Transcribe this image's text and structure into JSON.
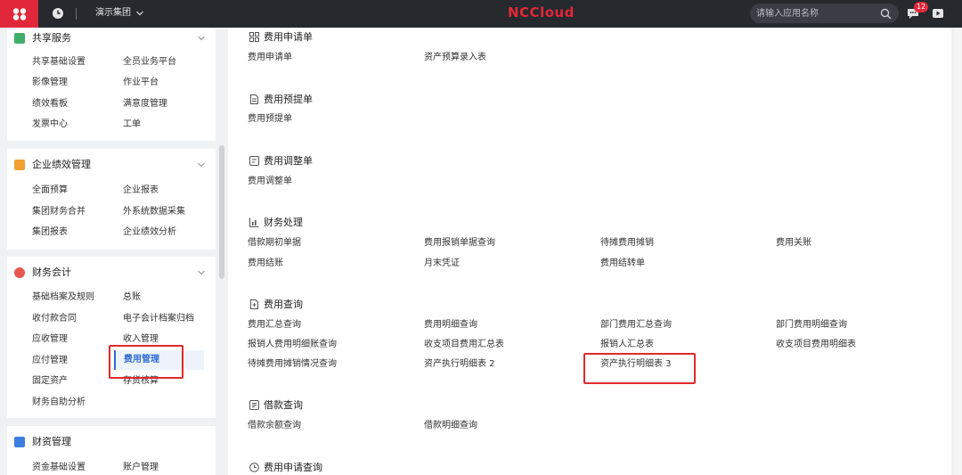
{
  "topbar": {
    "group_name": "演示集团",
    "brand": "NCCloud",
    "search_placeholder": "请输入应用名称",
    "message_count": "12"
  },
  "sidebar": {
    "sections": [
      {
        "title": "共享服务",
        "items": [
          "共享基础设置",
          "全员业务平台",
          "影像管理",
          "作业平台",
          "绩效看板",
          "满意度管理",
          "发票中心",
          "工单"
        ]
      },
      {
        "title": "企业绩效管理",
        "items": [
          "全面预算",
          "企业报表",
          "集团财务合并",
          "外系统数据采集",
          "集团报表",
          "企业绩效分析"
        ]
      },
      {
        "title": "财务会计",
        "items": [
          "基础档案及规则",
          "总账",
          "收付款合同",
          "电子会计档案归档",
          "应收管理",
          "收入管理",
          "应付管理",
          "费用管理",
          "固定资产",
          "存货核算",
          "财务自助分析"
        ]
      },
      {
        "title": "财资管理",
        "items": [
          "资金基础设置",
          "账户管理"
        ]
      }
    ]
  },
  "main": {
    "sections": [
      {
        "title": "费用申请单",
        "links": [
          "费用申请单",
          "资产预算录入表"
        ]
      },
      {
        "title": "费用预提单",
        "links": [
          "费用预提单"
        ]
      },
      {
        "title": "费用调整单",
        "links": [
          "费用调整单"
        ]
      },
      {
        "title": "财务处理",
        "links": [
          "借款期初单据",
          "费用报销单据查询",
          "待摊费用摊销",
          "费用关账",
          "费用结账",
          "月末凭证",
          "费用结转单"
        ]
      },
      {
        "title": "费用查询",
        "links": [
          "费用汇总查询",
          "费用明细查询",
          "部门费用汇总查询",
          "部门费用明细查询",
          "报销人费用明细账查询",
          "收支项目费用汇总表",
          "报销人汇总表",
          "收支项目费用明细表",
          "待摊费用摊销情况查询",
          "资产执行明细表 2",
          "资产执行明细表 3"
        ]
      },
      {
        "title": "借款查询",
        "links": [
          "借款余额查询",
          "借款明细查询"
        ]
      },
      {
        "title": "费用申请查询",
        "links": []
      }
    ]
  },
  "colors": {
    "accent_red": "#e1283a",
    "topbar": "#26292e",
    "highlight_box": "#e02a2a",
    "active_blue": "#2e6bd6"
  }
}
